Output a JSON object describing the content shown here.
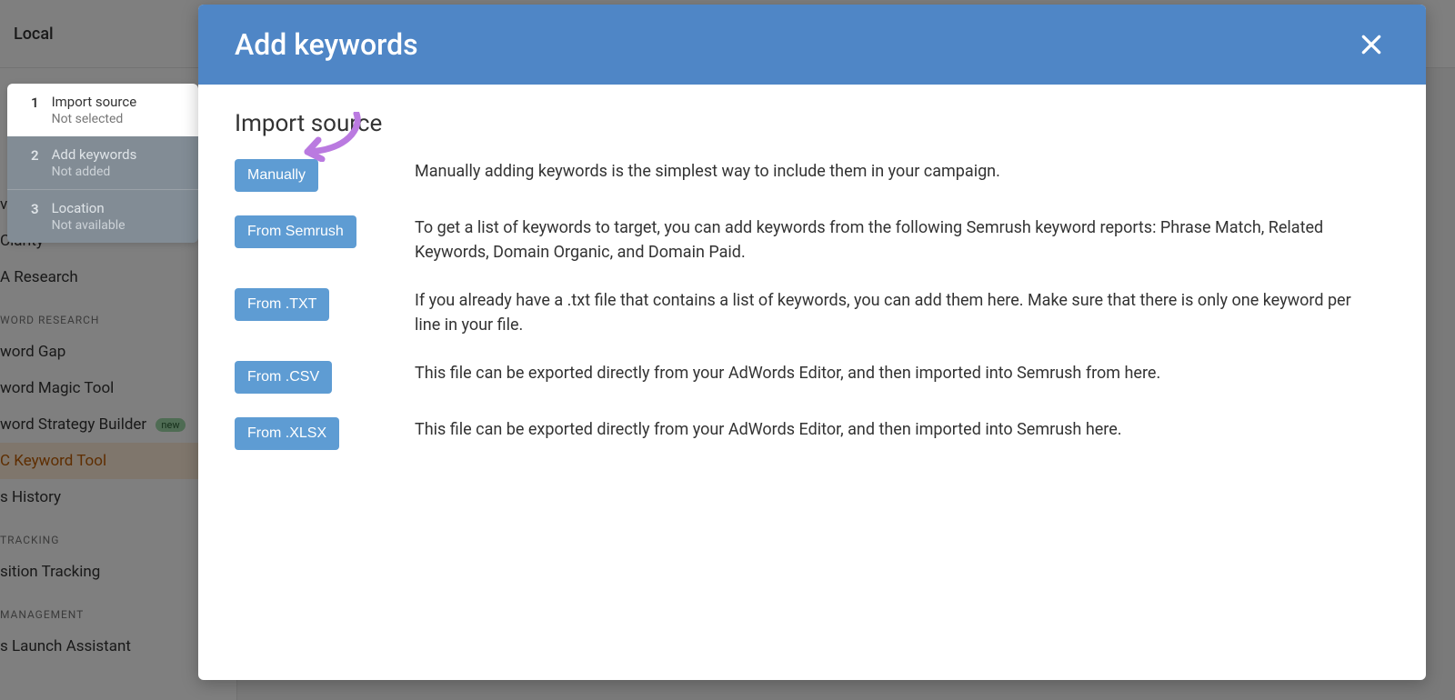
{
  "topbar": {
    "label": "Local"
  },
  "sidebar": {
    "items": [
      {
        "label": "vertising Research"
      },
      {
        "label": "Clarity"
      },
      {
        "label": "A Research"
      }
    ],
    "section_research": "WORD RESEARCH",
    "research_items": [
      {
        "label": "word Gap"
      },
      {
        "label": "word Magic Tool"
      },
      {
        "label": "word Strategy Builder",
        "badge": "new"
      },
      {
        "label": "C Keyword Tool",
        "active": true
      },
      {
        "label": "s History"
      }
    ],
    "section_tracking": "TRACKING",
    "tracking_items": [
      {
        "label": "sition Tracking"
      }
    ],
    "section_mgmt": "MANAGEMENT",
    "mgmt_items": [
      {
        "label": "s Launch Assistant"
      }
    ]
  },
  "wizard": {
    "steps": [
      {
        "num": "1",
        "title": "Import source",
        "sub": "Not selected",
        "active": true
      },
      {
        "num": "2",
        "title": "Add keywords",
        "sub": "Not added",
        "active": false
      },
      {
        "num": "3",
        "title": "Location",
        "sub": "Not available",
        "active": false
      }
    ]
  },
  "modal": {
    "title": "Add keywords",
    "section_title": "Import source",
    "sources": [
      {
        "button": "Manually",
        "desc": "Manually adding keywords is the simplest way to include them in your campaign."
      },
      {
        "button": "From Semrush",
        "desc": "To get a list of keywords to target, you can add keywords from the following Semrush keyword reports: Phrase Match, Related Keywords, Domain Organic, and Domain Paid."
      },
      {
        "button": "From .TXT",
        "desc": "If you already have a .txt file that contains a list of keywords, you can add them here. Make sure that there is only one keyword per line in your file."
      },
      {
        "button": "From .CSV",
        "desc": "This file can be exported directly from your AdWords Editor, and then imported into Semrush from here."
      },
      {
        "button": "From .XLSX",
        "desc": "This file can be exported directly from your AdWords Editor, and then imported into Semrush here."
      }
    ]
  },
  "annotation": {
    "arrow_color": "#c47ae8"
  }
}
